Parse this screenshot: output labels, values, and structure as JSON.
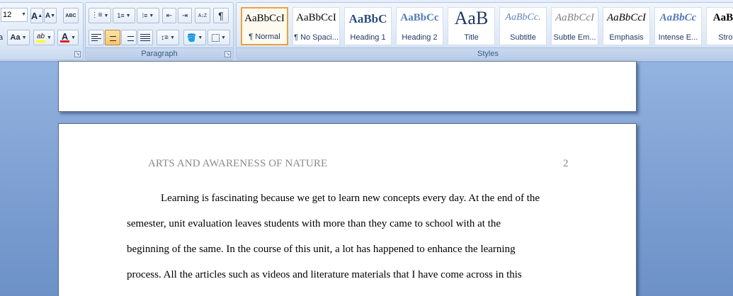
{
  "ribbon": {
    "font": {
      "size_value": "12",
      "grow_label": "A",
      "shrink_label": "A",
      "clear_label": "ABC",
      "change_case_label": "Aa",
      "highlight_label": "ab",
      "font_color_label": "A",
      "left_fragment": "a"
    },
    "paragraph": {
      "label": "Paragraph",
      "pilcrow": "¶",
      "sort_label": "A↓Z"
    },
    "styles": {
      "label": "Styles",
      "items": [
        {
          "preview": "AaBbCcI",
          "name": "¶ Normal",
          "selected": true
        },
        {
          "preview": "AaBbCcI",
          "name": "¶ No Spaci..."
        },
        {
          "preview": "AaBbC",
          "name": "Heading 1"
        },
        {
          "preview": "AaBbCc",
          "name": "Heading 2"
        },
        {
          "preview": "AaB",
          "name": "Title"
        },
        {
          "preview": "AaBbCc.",
          "name": "Subtitle"
        },
        {
          "preview": "AaBbCcI",
          "name": "Subtle Em..."
        },
        {
          "preview": "AaBbCcI",
          "name": "Emphasis"
        },
        {
          "preview": "AaBbCc",
          "name": "Intense E..."
        },
        {
          "preview": "AaBbC",
          "name": "Strong"
        }
      ]
    },
    "colors": {
      "highlight": "#ffff00",
      "font_color": "#e02020",
      "selection_border": "#e9a440"
    }
  },
  "document": {
    "running_head": "ARTS AND AWARENESS OF NATURE",
    "page_number": "2",
    "lines": [
      "Learning is fascinating because we get to learn new concepts every day. At the end of the",
      "semester, unit evaluation leaves students with more than they came to school with at the",
      "beginning of the same.  In the course of this unit, a lot has happened to enhance the learning",
      "process. All the articles such as videos and literature materials that I have come across in this"
    ]
  }
}
